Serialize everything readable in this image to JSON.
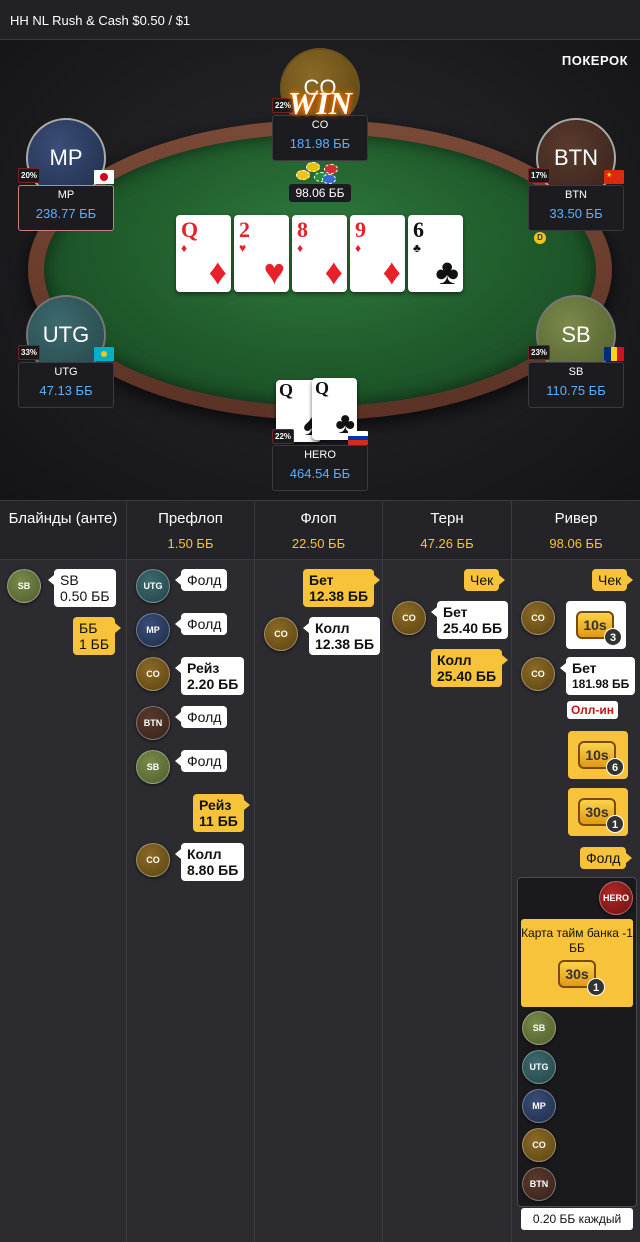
{
  "header": {
    "title": "HH NL Rush & Cash $0.50 / $1"
  },
  "brand": "ПОКЕРОК",
  "win_label": "WIN",
  "pot": "98.06 ББ",
  "seats": {
    "co": {
      "label": "CO",
      "position": "CO",
      "stack": "181.98 ББ",
      "pct": "22%"
    },
    "mp": {
      "label": "MP",
      "position": "MP",
      "stack": "238.77 ББ",
      "pct": "20%"
    },
    "btn": {
      "label": "BTN",
      "position": "BTN",
      "stack": "33.50 ББ",
      "pct": "17%"
    },
    "utg": {
      "label": "UTG",
      "position": "UTG",
      "stack": "47.13 ББ",
      "pct": "33%"
    },
    "sb": {
      "label": "SB",
      "position": "SB",
      "stack": "110.75 ББ",
      "pct": "23%"
    },
    "hero": {
      "position": "HERO",
      "stack": "464.54 ББ",
      "pct": "22%"
    }
  },
  "dealer_button": "D",
  "board": [
    {
      "rank": "Q",
      "suit": "♦",
      "color": "red"
    },
    {
      "rank": "2",
      "suit": "♥",
      "color": "red"
    },
    {
      "rank": "8",
      "suit": "♦",
      "color": "red"
    },
    {
      "rank": "9",
      "suit": "♦",
      "color": "red"
    },
    {
      "rank": "6",
      "suit": "♣",
      "color": "black"
    }
  ],
  "hero_cards": [
    {
      "rank": "Q",
      "suit": "♠"
    },
    {
      "rank": "Q",
      "suit": "♣"
    }
  ],
  "streets": [
    {
      "name": "Блайнды (анте)",
      "pot": ""
    },
    {
      "name": "Префлоп",
      "pot": "1.50 ББ"
    },
    {
      "name": "Флоп",
      "pot": "22.50 ББ"
    },
    {
      "name": "Терн",
      "pot": "47.26 ББ"
    },
    {
      "name": "Ривер",
      "pot": "98.06 ББ"
    }
  ],
  "blinds": {
    "sb_chip": "SB",
    "sb_action": "SB",
    "sb_amount": "0.50 ББ",
    "bb_action": "ББ",
    "bb_amount": "1 ББ"
  },
  "preflop": {
    "utg_chip": "UTG",
    "utg_action": "Фолд",
    "mp_chip": "MP",
    "mp_action": "Фолд",
    "co_chip": "CO",
    "co_action": "Рейз",
    "co_amount": "2.20 ББ",
    "btn_chip": "BTN",
    "btn_action": "Фолд",
    "sb_chip": "SB",
    "sb_action": "Фолд",
    "hero_action": "Рейз",
    "hero_amount": "11 ББ",
    "co2_chip": "CO",
    "co2_action": "Колл",
    "co2_amount": "8.80 ББ"
  },
  "flop": {
    "hero_action": "Бет",
    "hero_amount": "12.38 ББ",
    "co_chip": "CO",
    "co_action": "Колл",
    "co_amount": "12.38 ББ"
  },
  "turn": {
    "hero_check": "Чек",
    "co_chip": "CO",
    "co_action": "Бет",
    "co_amount": "25.40 ББ",
    "hero_action": "Колл",
    "hero_amount": "25.40 ББ"
  },
  "river": {
    "hero_check": "Чек",
    "co_chip": "CO",
    "tb1_label": "10s",
    "tb1_count": "3",
    "co2_chip": "CO",
    "co2_action": "Бет",
    "co2_amount": "181.98 ББ",
    "allin": "Олл-ин",
    "tb2_label": "10s",
    "tb2_count": "6",
    "tb3_label": "30s",
    "tb3_count": "1",
    "hero_fold": "Фолд"
  },
  "hero_panel": {
    "hero_chip": "HERO",
    "card_text": "Карта тайм банка -1 ББ",
    "tb_label": "30s",
    "tb_count": "1",
    "chips": [
      "SB",
      "UTG",
      "MP",
      "CO",
      "BTN"
    ],
    "ante_text": "0.20 ББ каждый"
  }
}
